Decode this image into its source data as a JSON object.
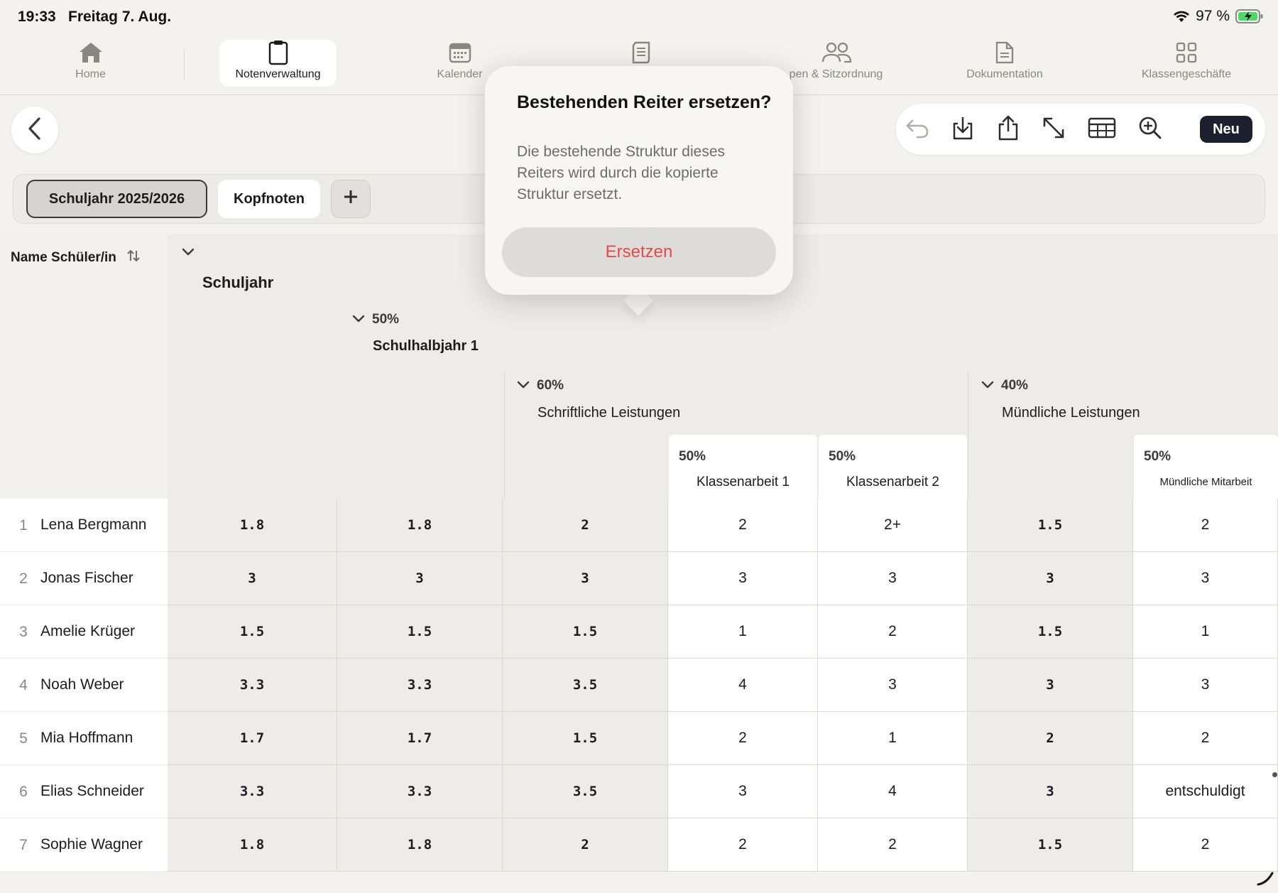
{
  "status": {
    "time": "19:33",
    "date": "Freitag 7. Aug.",
    "battery": "97 %"
  },
  "nav": {
    "home": "Home",
    "notenverwaltung": "Notenverwaltung",
    "kalender": "Kalender",
    "gruppen": "pen & Sitzordnung",
    "dokumentation": "Dokumentation",
    "klassengeschaefte": "Klassengeschäfte"
  },
  "toolbar": {
    "new_label": "Neu"
  },
  "tabs": {
    "active": "Schuljahr 2025/2026",
    "second": "Kopfnoten",
    "add": "+"
  },
  "table": {
    "name_header": "Name Schüler/in",
    "level0": {
      "label": "Schuljahr"
    },
    "level1": {
      "pct": "50%",
      "label": "Schulhalbjahr 1"
    },
    "level2a": {
      "pct": "60%",
      "label": "Schriftliche Leistungen"
    },
    "level2b": {
      "pct": "40%",
      "label": "Mündliche Leistungen"
    },
    "leaf1": {
      "pct": "50%",
      "label": "Klassenarbeit 1"
    },
    "leaf2": {
      "pct": "50%",
      "label": "Klassenarbeit 2"
    },
    "leaf3": {
      "pct": "50%",
      "label": "Mündliche Mitarbeit"
    },
    "rows": [
      {
        "num": "1",
        "name": "Lena Bergmann",
        "c": [
          "1.8",
          "1.8",
          "2",
          "2",
          "2+",
          "1.5",
          "2"
        ]
      },
      {
        "num": "2",
        "name": "Jonas Fischer",
        "c": [
          "3",
          "3",
          "3",
          "3",
          "3",
          "3",
          "3"
        ]
      },
      {
        "num": "3",
        "name": "Amelie Krüger",
        "c": [
          "1.5",
          "1.5",
          "1.5",
          "1",
          "2",
          "1.5",
          "1"
        ]
      },
      {
        "num": "4",
        "name": "Noah Weber",
        "c": [
          "3.3",
          "3.3",
          "3.5",
          "4",
          "3",
          "3",
          "3"
        ]
      },
      {
        "num": "5",
        "name": "Mia Hoffmann",
        "c": [
          "1.7",
          "1.7",
          "1.5",
          "2",
          "1",
          "2",
          "2"
        ]
      },
      {
        "num": "6",
        "name": "Elias Schneider",
        "c": [
          "3.3",
          "3.3",
          "3.5",
          "3",
          "4",
          "3",
          "entschuldigt"
        ]
      },
      {
        "num": "7",
        "name": "Sophie Wagner",
        "c": [
          "1.8",
          "1.8",
          "2",
          "2",
          "2",
          "1.5",
          "2"
        ]
      }
    ]
  },
  "popover": {
    "title": "Bestehenden Reiter ersetzen?",
    "message": "Die bestehende Struktur dieses Reiters wird durch die kopierte Struktur ersetzt.",
    "button": "Ersetzen"
  },
  "colors": {
    "accent_dark": "#1b1f2e",
    "destructive": "#e24b4b",
    "battery": "#4cd964"
  }
}
